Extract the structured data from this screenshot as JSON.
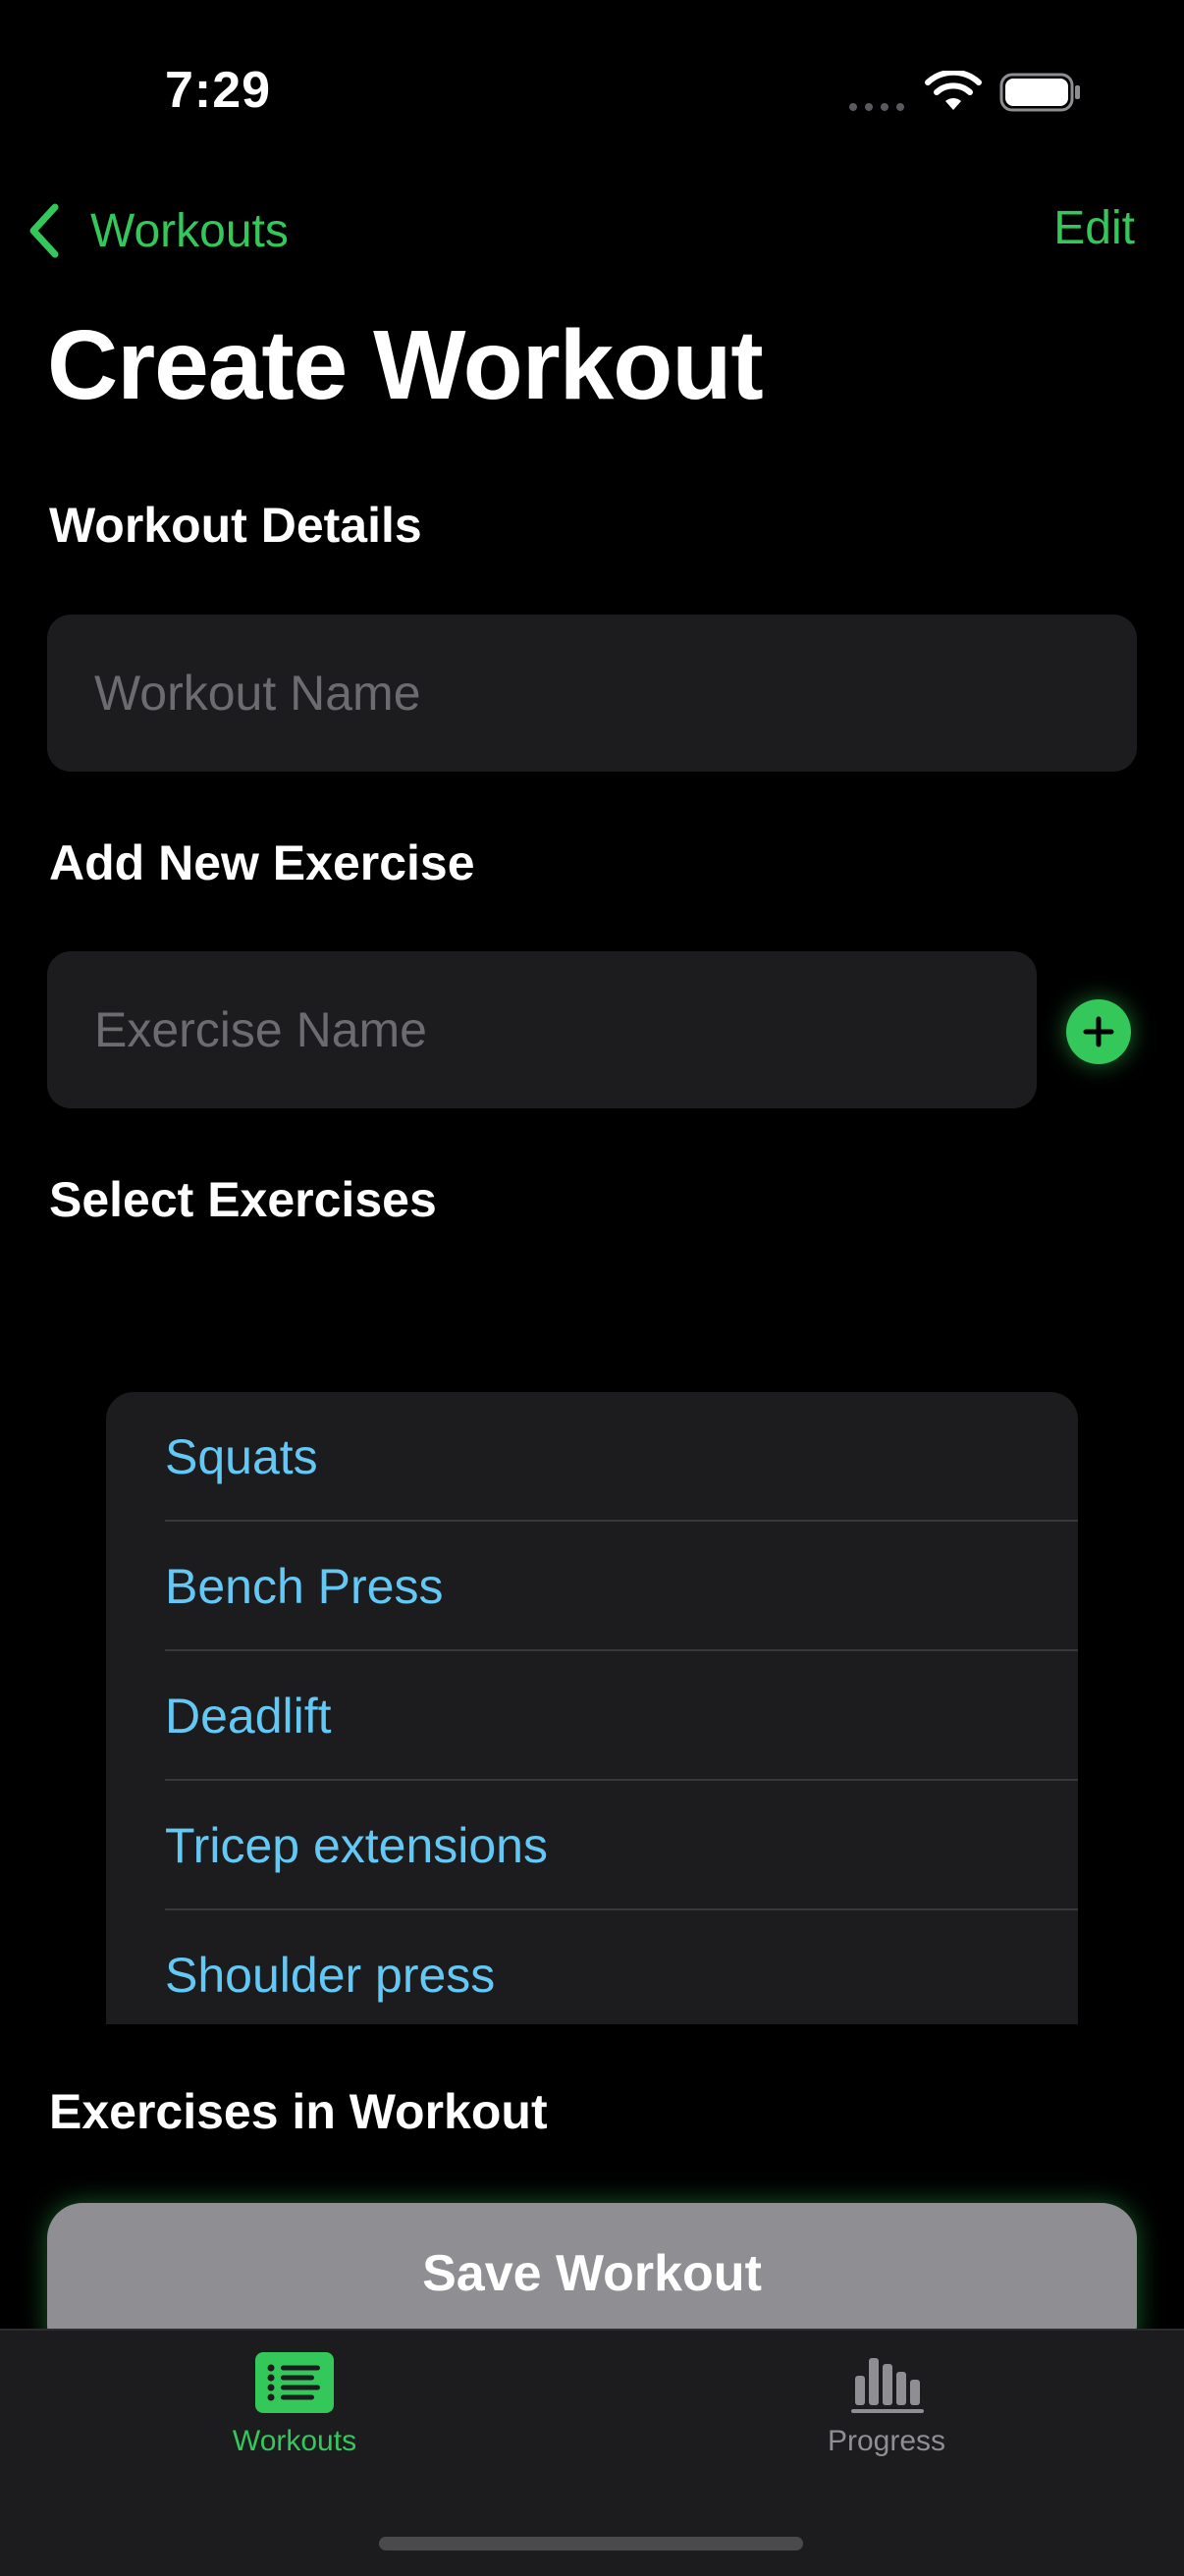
{
  "status_bar": {
    "time": "7:29"
  },
  "nav": {
    "back_label": "Workouts",
    "edit_label": "Edit",
    "title": "Create Workout"
  },
  "workout_details": {
    "header": "Workout Details",
    "name_placeholder": "Workout Name",
    "name_value": ""
  },
  "add_exercise": {
    "header": "Add New Exercise",
    "name_placeholder": "Exercise Name",
    "name_value": ""
  },
  "select_exercises": {
    "header": "Select Exercises",
    "items": [
      {
        "label": "Squats"
      },
      {
        "label": "Bench Press"
      },
      {
        "label": "Deadlift"
      },
      {
        "label": "Tricep extensions"
      },
      {
        "label": "Shoulder press"
      }
    ]
  },
  "exercises_in_workout": {
    "header": "Exercises in Workout"
  },
  "save_button": {
    "label": "Save Workout"
  },
  "tab_bar": {
    "tabs": [
      {
        "label": "Workouts",
        "icon": "list-icon",
        "selected": true
      },
      {
        "label": "Progress",
        "icon": "chart-bar-icon",
        "selected": false
      }
    ]
  },
  "colors": {
    "accent": "#34c759",
    "link": "#64c8f5",
    "background": "#000000",
    "card": "#1c1c1e",
    "save_button_disabled": "#8e8e93"
  }
}
